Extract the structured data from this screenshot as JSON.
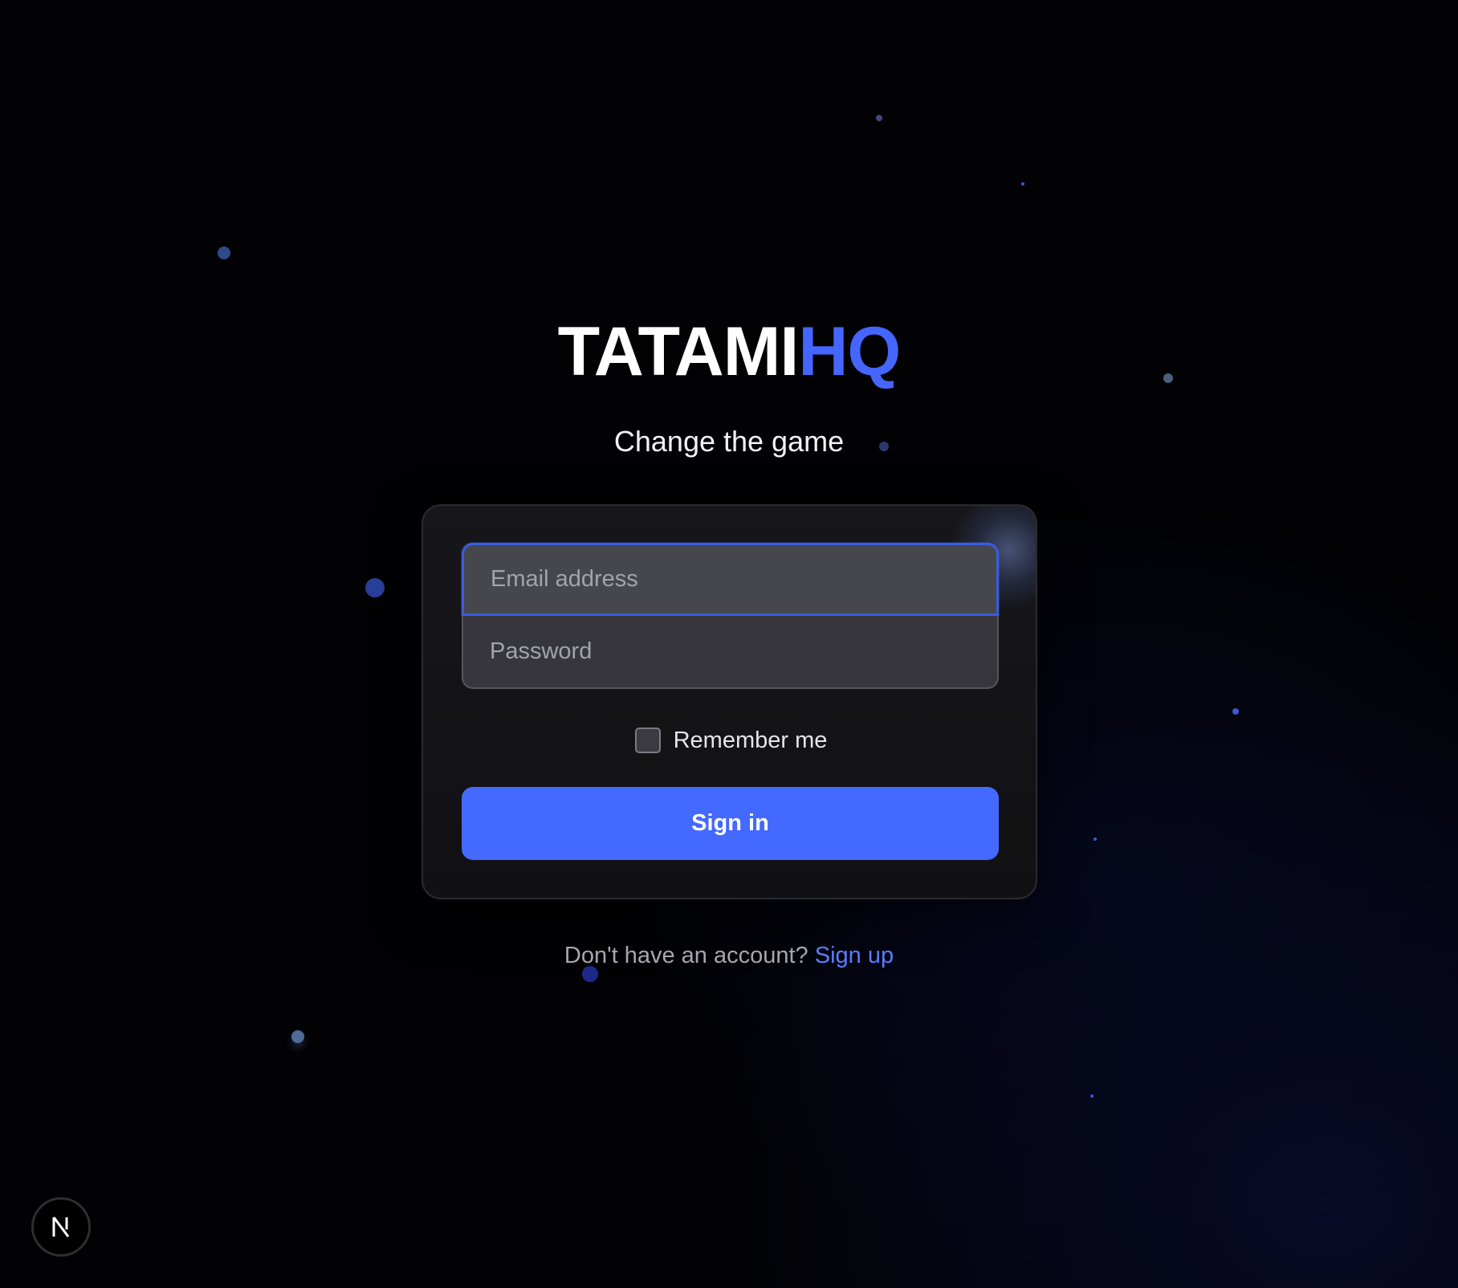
{
  "brand": {
    "part_white": "TATAMI",
    "part_accent": "HQ",
    "accent_color": "#4466ff"
  },
  "tagline": "Change the game",
  "login_form": {
    "email_placeholder": "Email address",
    "password_placeholder": "Password",
    "remember_label": "Remember me",
    "remember_checked": false,
    "submit_label": "Sign in",
    "button_color": "#4469ff"
  },
  "signup": {
    "prompt": "Don't have an account? ",
    "link_label": "Sign up"
  },
  "dev_badge": {
    "icon": "nextjs-n-icon"
  },
  "colors": {
    "background": "#020204",
    "card": "#141417",
    "focus_border": "#3a5ce0",
    "link": "#5a7cff"
  }
}
